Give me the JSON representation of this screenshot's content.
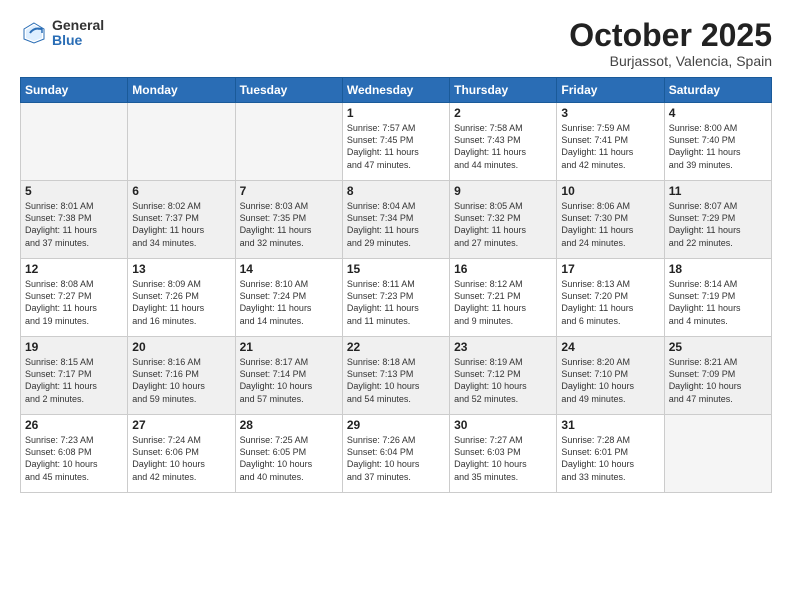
{
  "header": {
    "logo_general": "General",
    "logo_blue": "Blue",
    "month_title": "October 2025",
    "location": "Burjassot, Valencia, Spain"
  },
  "weekdays": [
    "Sunday",
    "Monday",
    "Tuesday",
    "Wednesday",
    "Thursday",
    "Friday",
    "Saturday"
  ],
  "weeks": [
    [
      {
        "day": "",
        "info": ""
      },
      {
        "day": "",
        "info": ""
      },
      {
        "day": "",
        "info": ""
      },
      {
        "day": "1",
        "info": "Sunrise: 7:57 AM\nSunset: 7:45 PM\nDaylight: 11 hours\nand 47 minutes."
      },
      {
        "day": "2",
        "info": "Sunrise: 7:58 AM\nSunset: 7:43 PM\nDaylight: 11 hours\nand 44 minutes."
      },
      {
        "day": "3",
        "info": "Sunrise: 7:59 AM\nSunset: 7:41 PM\nDaylight: 11 hours\nand 42 minutes."
      },
      {
        "day": "4",
        "info": "Sunrise: 8:00 AM\nSunset: 7:40 PM\nDaylight: 11 hours\nand 39 minutes."
      }
    ],
    [
      {
        "day": "5",
        "info": "Sunrise: 8:01 AM\nSunset: 7:38 PM\nDaylight: 11 hours\nand 37 minutes."
      },
      {
        "day": "6",
        "info": "Sunrise: 8:02 AM\nSunset: 7:37 PM\nDaylight: 11 hours\nand 34 minutes."
      },
      {
        "day": "7",
        "info": "Sunrise: 8:03 AM\nSunset: 7:35 PM\nDaylight: 11 hours\nand 32 minutes."
      },
      {
        "day": "8",
        "info": "Sunrise: 8:04 AM\nSunset: 7:34 PM\nDaylight: 11 hours\nand 29 minutes."
      },
      {
        "day": "9",
        "info": "Sunrise: 8:05 AM\nSunset: 7:32 PM\nDaylight: 11 hours\nand 27 minutes."
      },
      {
        "day": "10",
        "info": "Sunrise: 8:06 AM\nSunset: 7:30 PM\nDaylight: 11 hours\nand 24 minutes."
      },
      {
        "day": "11",
        "info": "Sunrise: 8:07 AM\nSunset: 7:29 PM\nDaylight: 11 hours\nand 22 minutes."
      }
    ],
    [
      {
        "day": "12",
        "info": "Sunrise: 8:08 AM\nSunset: 7:27 PM\nDaylight: 11 hours\nand 19 minutes."
      },
      {
        "day": "13",
        "info": "Sunrise: 8:09 AM\nSunset: 7:26 PM\nDaylight: 11 hours\nand 16 minutes."
      },
      {
        "day": "14",
        "info": "Sunrise: 8:10 AM\nSunset: 7:24 PM\nDaylight: 11 hours\nand 14 minutes."
      },
      {
        "day": "15",
        "info": "Sunrise: 8:11 AM\nSunset: 7:23 PM\nDaylight: 11 hours\nand 11 minutes."
      },
      {
        "day": "16",
        "info": "Sunrise: 8:12 AM\nSunset: 7:21 PM\nDaylight: 11 hours\nand 9 minutes."
      },
      {
        "day": "17",
        "info": "Sunrise: 8:13 AM\nSunset: 7:20 PM\nDaylight: 11 hours\nand 6 minutes."
      },
      {
        "day": "18",
        "info": "Sunrise: 8:14 AM\nSunset: 7:19 PM\nDaylight: 11 hours\nand 4 minutes."
      }
    ],
    [
      {
        "day": "19",
        "info": "Sunrise: 8:15 AM\nSunset: 7:17 PM\nDaylight: 11 hours\nand 2 minutes."
      },
      {
        "day": "20",
        "info": "Sunrise: 8:16 AM\nSunset: 7:16 PM\nDaylight: 10 hours\nand 59 minutes."
      },
      {
        "day": "21",
        "info": "Sunrise: 8:17 AM\nSunset: 7:14 PM\nDaylight: 10 hours\nand 57 minutes."
      },
      {
        "day": "22",
        "info": "Sunrise: 8:18 AM\nSunset: 7:13 PM\nDaylight: 10 hours\nand 54 minutes."
      },
      {
        "day": "23",
        "info": "Sunrise: 8:19 AM\nSunset: 7:12 PM\nDaylight: 10 hours\nand 52 minutes."
      },
      {
        "day": "24",
        "info": "Sunrise: 8:20 AM\nSunset: 7:10 PM\nDaylight: 10 hours\nand 49 minutes."
      },
      {
        "day": "25",
        "info": "Sunrise: 8:21 AM\nSunset: 7:09 PM\nDaylight: 10 hours\nand 47 minutes."
      }
    ],
    [
      {
        "day": "26",
        "info": "Sunrise: 7:23 AM\nSunset: 6:08 PM\nDaylight: 10 hours\nand 45 minutes."
      },
      {
        "day": "27",
        "info": "Sunrise: 7:24 AM\nSunset: 6:06 PM\nDaylight: 10 hours\nand 42 minutes."
      },
      {
        "day": "28",
        "info": "Sunrise: 7:25 AM\nSunset: 6:05 PM\nDaylight: 10 hours\nand 40 minutes."
      },
      {
        "day": "29",
        "info": "Sunrise: 7:26 AM\nSunset: 6:04 PM\nDaylight: 10 hours\nand 37 minutes."
      },
      {
        "day": "30",
        "info": "Sunrise: 7:27 AM\nSunset: 6:03 PM\nDaylight: 10 hours\nand 35 minutes."
      },
      {
        "day": "31",
        "info": "Sunrise: 7:28 AM\nSunset: 6:01 PM\nDaylight: 10 hours\nand 33 minutes."
      },
      {
        "day": "",
        "info": ""
      }
    ]
  ]
}
